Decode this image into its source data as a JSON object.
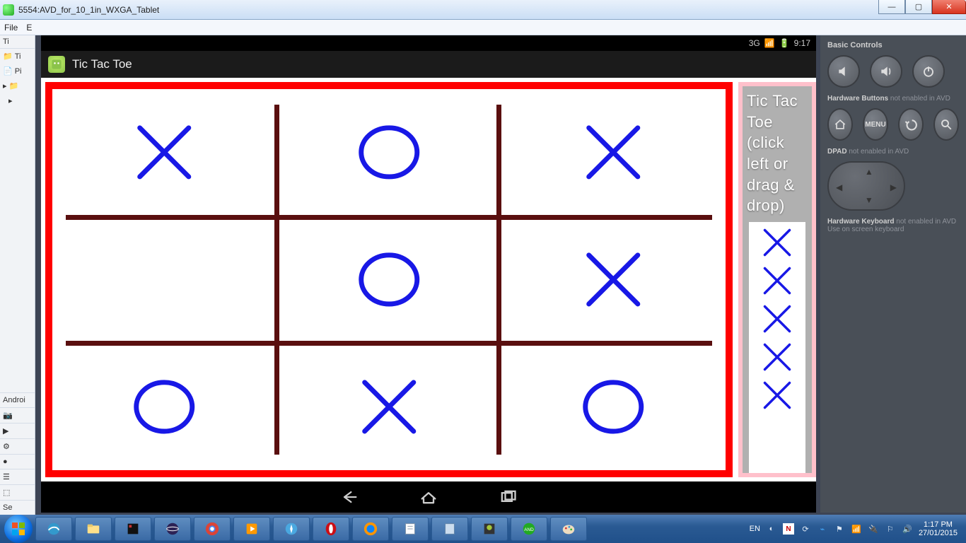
{
  "window": {
    "title": "5554:AVD_for_10_1in_WXGA_Tablet",
    "min": "—",
    "max": "▢",
    "close": "✕"
  },
  "menu": {
    "file": "File",
    "edit": "E"
  },
  "ide_left": {
    "t1": "Ti",
    "t2": "Ti",
    "t3": "Pi",
    "android": "Androi",
    "se": "Se"
  },
  "statusbar": {
    "net": "3G",
    "time": "9:17"
  },
  "app": {
    "title": "Tic Tac Toe"
  },
  "palette": {
    "label": "Tic Tac Toe (click left or drag & drop)",
    "pieces": [
      "X",
      "X",
      "X",
      "X",
      "X"
    ]
  },
  "board": {
    "cells": [
      "X",
      "O",
      "X",
      "",
      "O",
      "X",
      "O",
      "X",
      "O"
    ]
  },
  "emu_controls": {
    "basic": "Basic Controls",
    "hw_buttons": "Hardware Buttons",
    "hw_buttons_note": "not enabled in AVD",
    "menu": "MENU",
    "dpad": "DPAD",
    "dpad_note": "not enabled in AVD",
    "hw_kb": "Hardware Keyboard",
    "hw_kb_note": "not enabled in AVD",
    "hw_kb_sub": "Use on screen keyboard"
  },
  "taskbar": {
    "lang": "EN",
    "time": "1:17 PM",
    "date": "27/01/2015"
  }
}
